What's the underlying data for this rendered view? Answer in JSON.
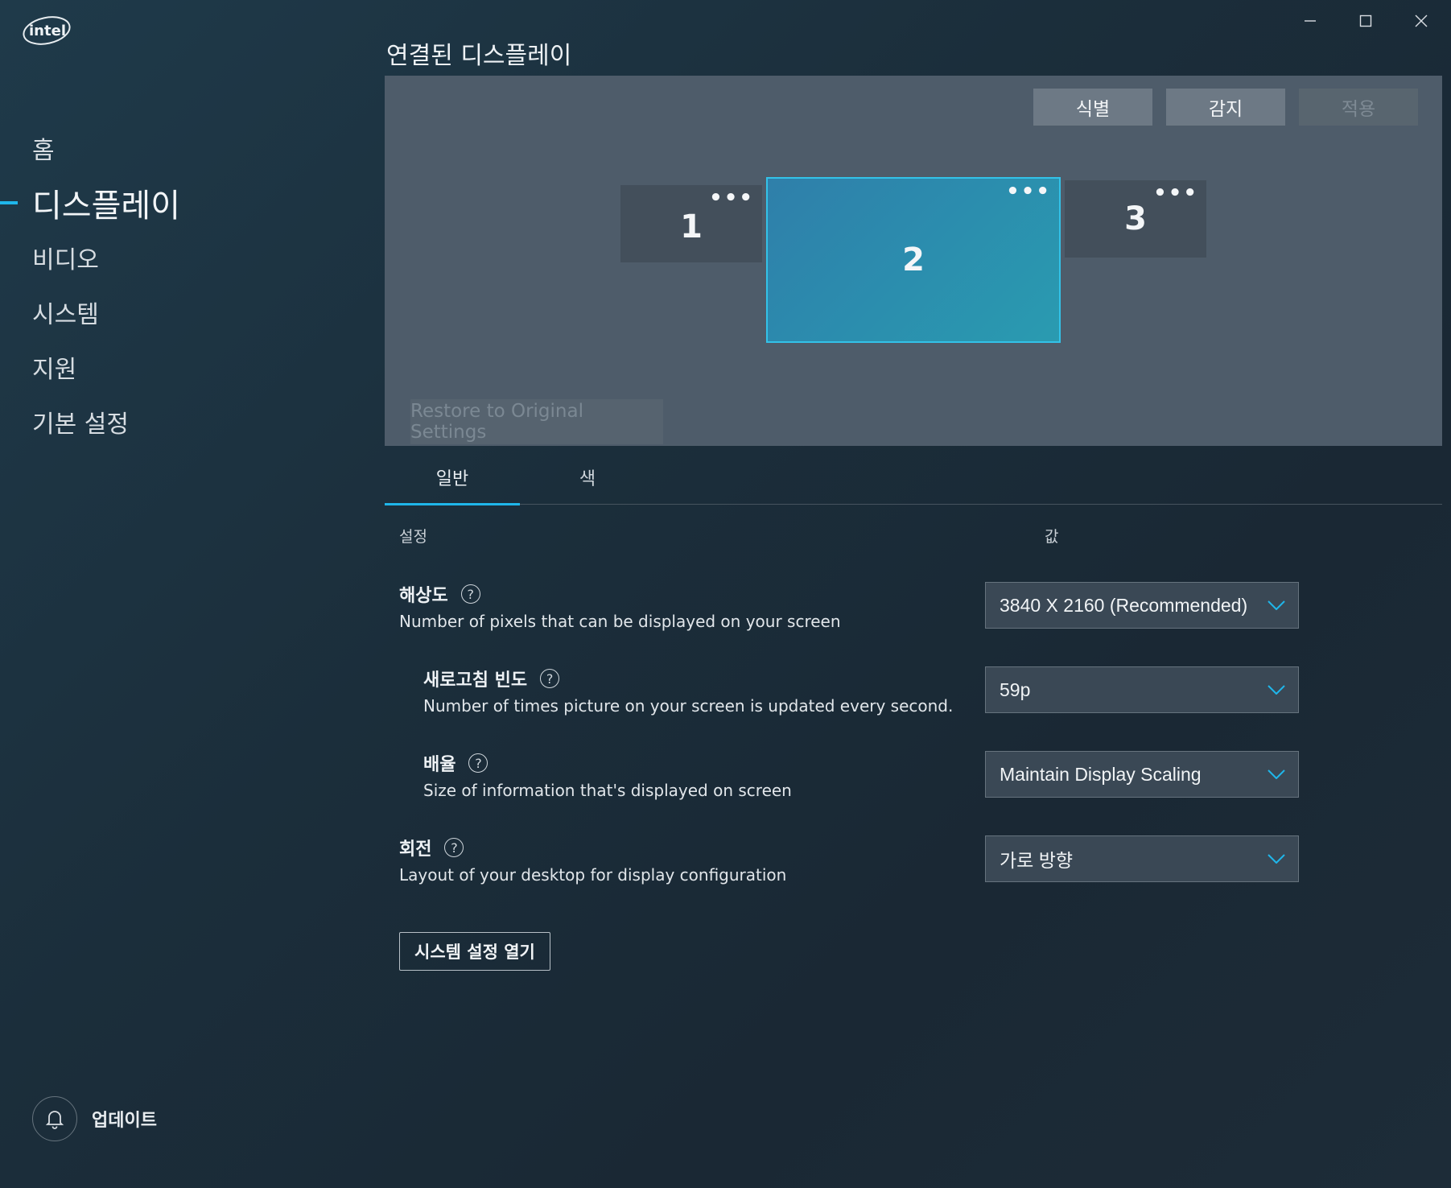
{
  "brand": {
    "logo_text": "intel"
  },
  "window": {
    "controls": [
      "minimize",
      "maximize",
      "close"
    ]
  },
  "sidebar": {
    "items": [
      {
        "label": "홈"
      },
      {
        "label": "디스플레이",
        "active": true
      },
      {
        "label": "비디오"
      },
      {
        "label": "시스템"
      },
      {
        "label": "지원"
      },
      {
        "label": "기본 설정"
      }
    ],
    "update_label": "업데이트"
  },
  "main": {
    "title": "연결된 디스플레이",
    "toolbar": {
      "identify": "식별",
      "detect": "감지",
      "apply": "적용"
    },
    "monitors": [
      {
        "label": "1",
        "more": "•••"
      },
      {
        "label": "2",
        "more": "•••",
        "selected": true
      },
      {
        "label": "3",
        "more": "•••"
      }
    ],
    "restore_label": "Restore to Original Settings",
    "tabs": [
      {
        "label": "일반",
        "active": true
      },
      {
        "label": "색"
      }
    ],
    "columns": {
      "setting": "설정",
      "value": "값"
    },
    "settings": [
      {
        "title": "해상도",
        "help": "?",
        "desc": "Number of pixels that can be displayed on your screen",
        "value": "3840 X 2160 (Recommended)"
      },
      {
        "title": "새로고침 빈도",
        "help": "?",
        "desc": "Number of times picture on your screen is updated every second.",
        "value": "59p"
      },
      {
        "title": "배율",
        "help": "?",
        "desc": "Size of information that's displayed on screen",
        "value": "Maintain Display Scaling"
      },
      {
        "title": "회전",
        "help": "?",
        "desc": "Layout of your desktop for display configuration",
        "value": "가로 방향"
      }
    ],
    "open_system_settings": "시스템 설정 열기"
  },
  "colors": {
    "accent": "#1fb6ea",
    "panel": "#4e5c6a",
    "selected_monitor": "#2b8dae"
  }
}
